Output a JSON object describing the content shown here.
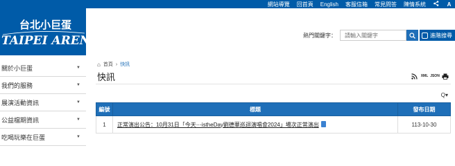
{
  "topbar": {
    "links": [
      "網站導覽",
      "回首頁",
      "English",
      "客服信箱",
      "常見問答",
      "陳情系統"
    ],
    "icons": [
      "share-icon",
      "font-size-icon"
    ]
  },
  "logo": {
    "chinese": "台北小巨蛋",
    "english": "TAIPEI ARENA"
  },
  "search": {
    "label": "熱門關鍵字：",
    "placeholder": "請輸入關鍵字",
    "advanced_label": "進階搜尋"
  },
  "sidebar": {
    "items": [
      {
        "label": "關於小巨蛋"
      },
      {
        "label": "我們的服務"
      },
      {
        "label": "展演活動資訊"
      },
      {
        "label": "公益檔期資訊"
      },
      {
        "label": "吃喝玩樂在巨蛋"
      }
    ]
  },
  "breadcrumb": {
    "home": "首頁",
    "separator": "›",
    "current": "快訊"
  },
  "page": {
    "title": "快訊"
  },
  "tools": {
    "rss": "RSS",
    "xml": "XML",
    "json": "JSON",
    "print": "print"
  },
  "filter": {
    "label": "Q▾"
  },
  "table": {
    "headers": [
      "編號",
      "標題",
      "發布日期"
    ],
    "rows": [
      {
        "no": "1",
        "title": "正常演出公告：10月31日「今天⋯istheDay劉德華巡迴演唱會2024」場次正常演出",
        "date": "113-10-30"
      }
    ]
  },
  "colors": {
    "brand_blue": "#005ba8",
    "table_header": "#1f6fb8"
  }
}
